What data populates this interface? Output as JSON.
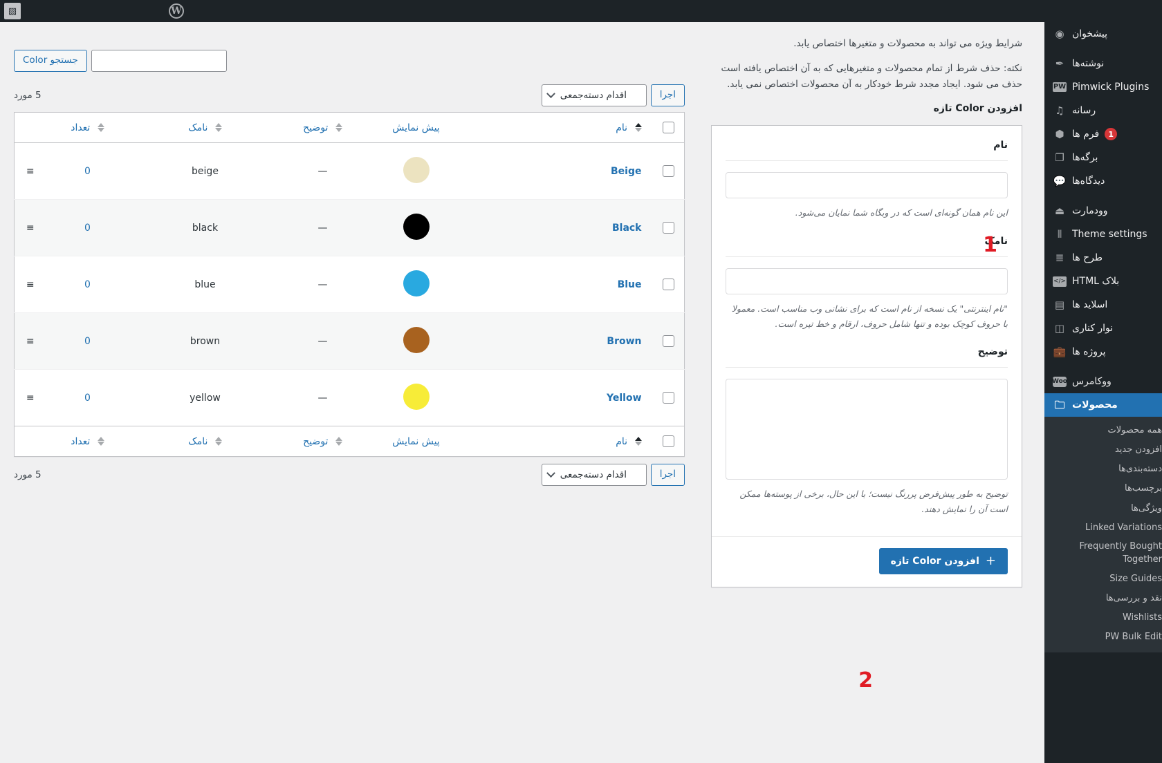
{
  "adminbar": {
    "wp_logo_icon": "wordpress-logo-icon",
    "site_icon": "site-placeholder-icon"
  },
  "sidebar": {
    "items": [
      {
        "label": "پیشخوان",
        "icon": "dashboard-icon",
        "spaced": false,
        "badge": null,
        "current": false
      },
      {
        "label": "نوشته‌ها",
        "icon": "pin-icon",
        "spaced": true,
        "badge": null,
        "current": false
      },
      {
        "label": "Pimwick Plugins",
        "icon": "pw-icon",
        "spaced": false,
        "badge": null,
        "current": false
      },
      {
        "label": "رسانه",
        "icon": "media-icon",
        "spaced": false,
        "badge": null,
        "current": false
      },
      {
        "label": "فرم ها",
        "icon": "forms-icon",
        "spaced": false,
        "badge": "1",
        "current": false
      },
      {
        "label": "برگه‌ها",
        "icon": "pages-icon",
        "spaced": false,
        "badge": null,
        "current": false
      },
      {
        "label": "دیدگاه‌ها",
        "icon": "comments-icon",
        "spaced": false,
        "badge": null,
        "current": false
      },
      {
        "label": "وودمارت",
        "icon": "woodmart-icon",
        "spaced": true,
        "badge": null,
        "current": false
      },
      {
        "label": "Theme settings",
        "icon": "sliders-icon",
        "spaced": false,
        "badge": null,
        "current": false
      },
      {
        "label": "طرح ها",
        "icon": "layers-icon",
        "spaced": false,
        "badge": null,
        "current": false
      },
      {
        "label": "بلاک HTML",
        "icon": "code-icon",
        "spaced": false,
        "badge": null,
        "current": false
      },
      {
        "label": "اسلاید ها",
        "icon": "slides-icon",
        "spaced": false,
        "badge": null,
        "current": false
      },
      {
        "label": "نوار کناری",
        "icon": "sidebar-icon",
        "spaced": false,
        "badge": null,
        "current": false
      },
      {
        "label": "پروژه ها",
        "icon": "portfolio-icon",
        "spaced": false,
        "badge": null,
        "current": false
      },
      {
        "label": "ووکامرس",
        "icon": "woo-icon",
        "spaced": true,
        "badge": null,
        "current": false
      },
      {
        "label": "محصولات",
        "icon": "products-icon",
        "spaced": false,
        "badge": null,
        "current": true
      }
    ],
    "submenu": [
      "همه محصولات",
      "افزودن جدید",
      "دسته‌بندی‌ها",
      "برچسب‌ها",
      "ویژگی‌ها",
      "Linked Variations",
      "Frequently Bought Together",
      "Size Guides",
      "نقد و بررسی‌ها",
      "Wishlists",
      "PW Bulk Edit"
    ]
  },
  "form_panel": {
    "intro_line1": "شرایط ویژه می تواند به محصولات و متغیرها اختصاص یابد.",
    "intro_note": "نکته: حذف شرط از تمام محصولات و متغیرهایی که به آن اختصاص یافته است حذف می شود. ایجاد مجدد شرط خودکار به آن محصولات اختصاص نمی یابد.",
    "title": "افزودن Color تازه",
    "name": {
      "label": "نام",
      "value": "",
      "placeholder": "",
      "help": "این نام همان گونه‌ای است که در وبگاه شما نمایان می‌شود."
    },
    "slug": {
      "label": "نامک",
      "value": "",
      "placeholder": "",
      "help": "\"نام اینترنتی\" یک نسخه از نام است که برای نشانی وب مناسب است. معمولا با حروف کوچک بوده و تنها شامل حروف، ارقام و خط تیره است."
    },
    "description": {
      "label": "توضیح",
      "value": "",
      "placeholder": "",
      "help": "توضیح به طور پیش‌فرض پررنگ نیست؛ با این حال، برخی از پوسته‌ها ممکن است آن را نمایش دهند."
    },
    "submit_label": "افزودن Color تازه",
    "submit_icon": "plus-icon",
    "annotation_field": "1",
    "annotation_submit": "2"
  },
  "list_panel": {
    "search": {
      "button_label": "جستجو Color",
      "input_value": "",
      "placeholder": ""
    },
    "count_top": "5 مورد",
    "count_bottom": "5 مورد",
    "bulk": {
      "selected": "اقدام دسته‌جمعی",
      "apply_label": "اجرا",
      "chevron_icon": "chevron-down-icon"
    },
    "columns": {
      "checkbox": "",
      "name": "نام",
      "preview": "پیش نمایش",
      "description": "توضیح",
      "slug": "نامک",
      "count": "تعداد",
      "handle": ""
    },
    "rows": [
      {
        "name": "Beige",
        "swatch": "#ece3c0",
        "description": "—",
        "slug": "beige",
        "count": "0",
        "handle_icon": "drag-handle-icon"
      },
      {
        "name": "Black",
        "swatch": "#000000",
        "description": "—",
        "slug": "black",
        "count": "0",
        "handle_icon": "drag-handle-icon"
      },
      {
        "name": "Blue",
        "swatch": "#29a9e0",
        "description": "—",
        "slug": "blue",
        "count": "0",
        "handle_icon": "drag-handle-icon"
      },
      {
        "name": "Brown",
        "swatch": "#a8621f",
        "description": "—",
        "slug": "brown",
        "count": "0",
        "handle_icon": "drag-handle-icon"
      },
      {
        "name": "Yellow",
        "swatch": "#f7ec38",
        "description": "—",
        "slug": "yellow",
        "count": "0",
        "handle_icon": "drag-handle-icon"
      }
    ]
  },
  "colors": {
    "accent": "#2271b1",
    "sidebar_bg": "#1d2327",
    "submenu_bg": "#2c3338",
    "annotation": "#e01b24",
    "badge": "#d63638"
  }
}
